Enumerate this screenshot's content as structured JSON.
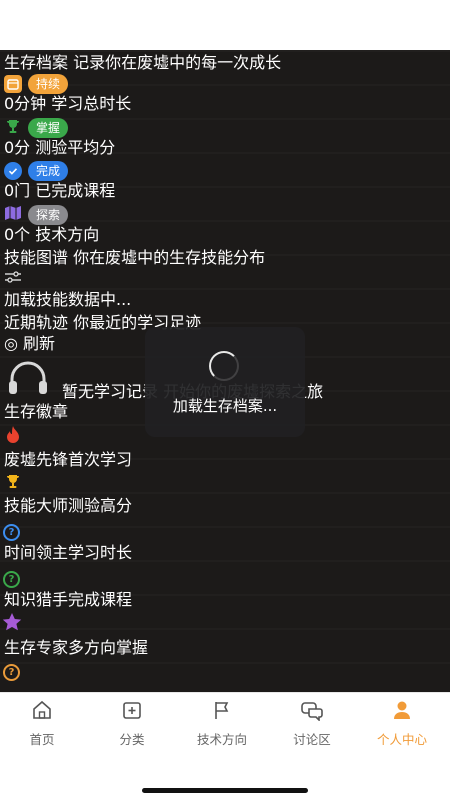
{
  "header": {
    "title": "生存档案 记录你在废墟中的每一次成长"
  },
  "stats": [
    {
      "badge": "持续",
      "badge_color": "#f2a33a",
      "icon": "calendar-icon",
      "value_text": "0分钟 学习总时长"
    },
    {
      "badge": "掌握",
      "badge_color": "#3aa84a",
      "icon": "trophy-icon",
      "value_text": "0分 测验平均分"
    },
    {
      "badge": "完成",
      "badge_color": "#2f7fe8",
      "icon": "check-circle-icon",
      "value_text": "0门 已完成课程"
    },
    {
      "badge": "探索",
      "badge_color": "#8a8a8e",
      "icon": "map-icon",
      "value_text": "0个 技术方向"
    }
  ],
  "skills": {
    "title": "技能图谱 你在废墟中的生存技能分布",
    "icon": "sliders-icon",
    "loading_text": "加载技能数据中..."
  },
  "recent": {
    "title": "近期轨迹 你最近的学习足迹",
    "refresh_label": "◎ 刷新",
    "empty_icon": "headphones-icon",
    "empty_text": "暂无学习记录 开始你的废墟探索之旅"
  },
  "badges": {
    "title": "生存徽章",
    "items": [
      {
        "icon": "flame-icon",
        "label": "废墟先锋首次学习"
      },
      {
        "icon": "trophy-icon",
        "label": "技能大师测验高分"
      },
      {
        "icon": "question-circle-icon",
        "label": "时间领主学习时长",
        "color": "#3c8ef0"
      },
      {
        "icon": "question-circle-icon",
        "label": "知识猎手完成课程",
        "color": "#3aa84a"
      },
      {
        "icon": "star-icon",
        "label": "生存专家多方向掌握",
        "color": "#a65bd6"
      },
      {
        "icon": "question-circle-icon",
        "label": "",
        "color": "#e89a3a"
      }
    ]
  },
  "overlay": {
    "text": "加载生存档案..."
  },
  "tabbar": {
    "tabs": [
      {
        "label": "首页",
        "icon": "home-icon"
      },
      {
        "label": "分类",
        "icon": "add-square-icon"
      },
      {
        "label": "技术方向",
        "icon": "flag-icon"
      },
      {
        "label": "讨论区",
        "icon": "chat-icon"
      },
      {
        "label": "个人中心",
        "icon": "user-icon",
        "active": true
      }
    ],
    "active_color": "#f19b38"
  }
}
